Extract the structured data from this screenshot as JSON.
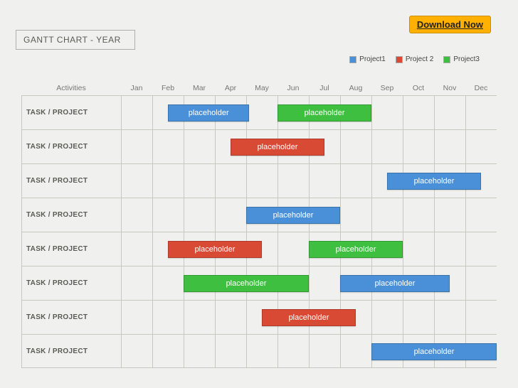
{
  "download_label": "Download Now",
  "title": "GANTT CHART - YEAR",
  "legend": [
    {
      "label": "Project1",
      "class": "sw1"
    },
    {
      "label": "Project 2",
      "class": "sw2"
    },
    {
      "label": "Project3",
      "class": "sw3"
    }
  ],
  "activities_header": "Activities",
  "months": [
    "Jan",
    "Feb",
    "Mar",
    "Apr",
    "May",
    "Jun",
    "Jul",
    "Aug",
    "Sep",
    "Oct",
    "Nov",
    "Dec"
  ],
  "row_label": "TASK / PROJECT",
  "bar_label": "placeholder",
  "chart_data": {
    "type": "bar",
    "title": "GANTT CHART - YEAR",
    "xlabel": "",
    "ylabel": "Activities",
    "categories": [
      "Jan",
      "Feb",
      "Mar",
      "Apr",
      "May",
      "Jun",
      "Jul",
      "Aug",
      "Sep",
      "Oct",
      "Nov",
      "Dec"
    ],
    "series": [
      {
        "name": "Project1",
        "color": "#4a90d9"
      },
      {
        "name": "Project 2",
        "color": "#d94a35"
      },
      {
        "name": "Project3",
        "color": "#3fbf3f"
      }
    ],
    "rows": [
      {
        "label": "TASK / PROJECT",
        "bars": [
          {
            "series": "Project1",
            "start": 1.5,
            "end": 4.1,
            "label": "placeholder"
          },
          {
            "series": "Project3",
            "start": 5.0,
            "end": 8.0,
            "label": "placeholder"
          }
        ]
      },
      {
        "label": "TASK / PROJECT",
        "bars": [
          {
            "series": "Project 2",
            "start": 3.5,
            "end": 6.5,
            "label": "placeholder"
          }
        ]
      },
      {
        "label": "TASK / PROJECT",
        "bars": [
          {
            "series": "Project1",
            "start": 8.5,
            "end": 11.5,
            "label": "placeholder"
          }
        ]
      },
      {
        "label": "TASK / PROJECT",
        "bars": [
          {
            "series": "Project1",
            "start": 4.0,
            "end": 7.0,
            "label": "placeholder"
          }
        ]
      },
      {
        "label": "TASK / PROJECT",
        "bars": [
          {
            "series": "Project 2",
            "start": 1.5,
            "end": 4.5,
            "label": "placeholder"
          },
          {
            "series": "Project3",
            "start": 6.0,
            "end": 9.0,
            "label": "placeholder"
          }
        ]
      },
      {
        "label": "TASK / PROJECT",
        "bars": [
          {
            "series": "Project3",
            "start": 2.0,
            "end": 6.0,
            "label": "placeholder"
          },
          {
            "series": "Project1",
            "start": 7.0,
            "end": 10.5,
            "label": "placeholder"
          }
        ]
      },
      {
        "label": "TASK / PROJECT",
        "bars": [
          {
            "series": "Project 2",
            "start": 4.5,
            "end": 7.5,
            "label": "placeholder"
          }
        ]
      },
      {
        "label": "TASK / PROJECT",
        "bars": [
          {
            "series": "Project1",
            "start": 8.0,
            "end": 12.0,
            "label": "placeholder"
          }
        ]
      }
    ]
  }
}
